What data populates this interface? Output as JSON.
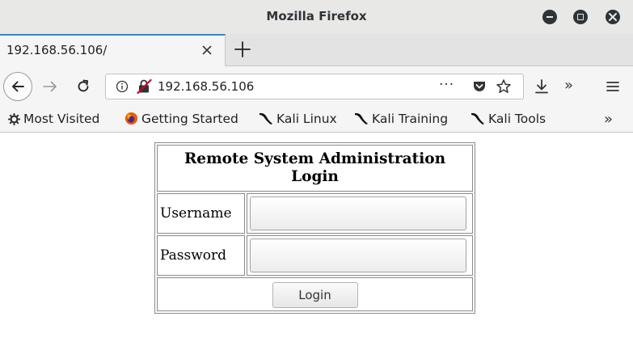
{
  "window": {
    "title": "Mozilla Firefox"
  },
  "tabs": [
    {
      "label": "192.168.56.106/"
    }
  ],
  "urlbar": {
    "url": "192.168.56.106",
    "more_label": "···"
  },
  "toolbar": {
    "overflow_label": "»"
  },
  "bookmarks": {
    "items": [
      {
        "label": "Most Visited",
        "icon": "gear-icon"
      },
      {
        "label": "Getting Started",
        "icon": "firefox-icon"
      },
      {
        "label": "Kali Linux",
        "icon": "kali-dragon-icon"
      },
      {
        "label": "Kali Training",
        "icon": "kali-dragon-icon"
      },
      {
        "label": "Kali Tools",
        "icon": "kali-dragon-icon"
      }
    ],
    "overflow_label": "»"
  },
  "page": {
    "heading": "Remote System Administration Login",
    "username_label": "Username",
    "password_label": "Password",
    "username_value": "",
    "password_value": "",
    "login_button": "Login"
  },
  "colors": {
    "tab_accent": "#2a8ad4",
    "chrome_bg": "#e8e8e7",
    "firefox_orange": "#e66000",
    "insecure_red": "#d70022"
  }
}
